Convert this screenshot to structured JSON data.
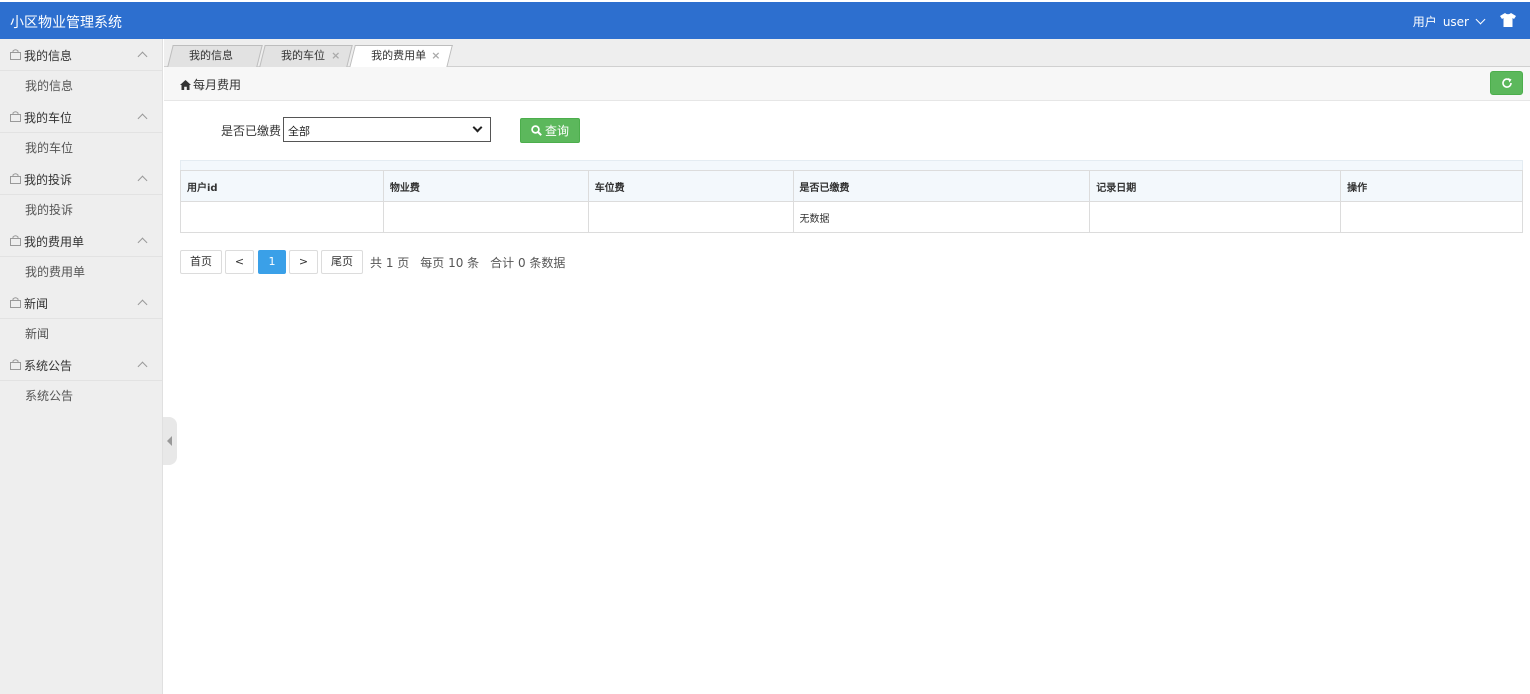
{
  "app": {
    "title": "小区物业管理系统"
  },
  "header": {
    "user_label": "用户",
    "username": "user",
    "skin_icon": "shirt-icon"
  },
  "sidebar": {
    "groups": [
      {
        "label": "我的信息",
        "items": [
          "我的信息"
        ]
      },
      {
        "label": "我的车位",
        "items": [
          "我的车位"
        ]
      },
      {
        "label": "我的投诉",
        "items": [
          "我的投诉"
        ]
      },
      {
        "label": "我的费用单",
        "items": [
          "我的费用单"
        ]
      },
      {
        "label": "新闻",
        "items": [
          "新闻"
        ]
      },
      {
        "label": "系统公告",
        "items": [
          "系统公告"
        ]
      }
    ]
  },
  "tabs": [
    {
      "label": "我的信息",
      "closable": false,
      "active": false
    },
    {
      "label": "我的车位",
      "closable": true,
      "active": false
    },
    {
      "label": "我的费用单",
      "closable": true,
      "active": true
    }
  ],
  "close_glyph": "×",
  "breadcrumb": {
    "label": "每月费用"
  },
  "filter": {
    "label": "是否已缴费",
    "selected": "全部",
    "query_label": "查询"
  },
  "table": {
    "headers": [
      "用户id",
      "物业费",
      "车位费",
      "是否已缴费",
      "记录日期",
      "操作"
    ],
    "empty_text": "无数据"
  },
  "pagination": {
    "first": "首页",
    "prev": "<",
    "current": "1",
    "next": ">",
    "last": "尾页",
    "total_pages_text": "共 1 页",
    "page_size_text": "每页 10 条",
    "total_records_text": "合计 0 条数据"
  },
  "colors": {
    "header_bg": "#2d6fcf",
    "success": "#5cb85c",
    "page_active": "#3aa0e8"
  }
}
